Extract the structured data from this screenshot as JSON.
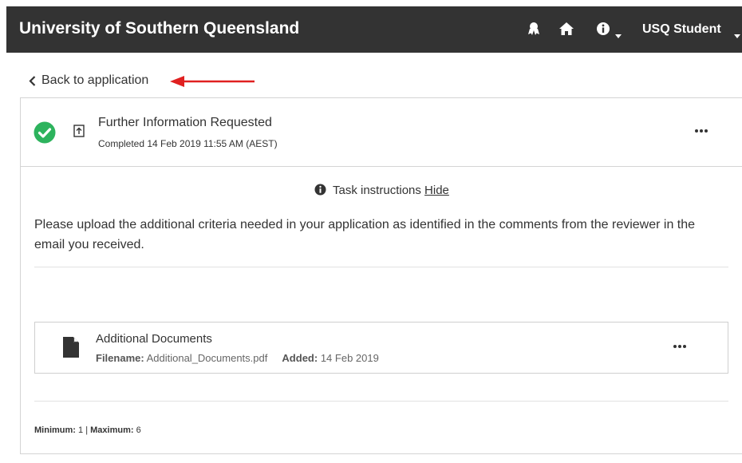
{
  "header": {
    "title": "University of Southern Queensland",
    "user_label": "USQ Student",
    "bg_color": "#333333"
  },
  "back_link": {
    "label": "Back to application"
  },
  "annotation_color": "#e02020",
  "task": {
    "title": "Further Information Requested",
    "status": "Completed 14 Feb 2019 11:55 AM (AEST)",
    "status_color": "#2db35d"
  },
  "instructions": {
    "heading": "Task instructions",
    "hide_label": "Hide",
    "body": "Please upload the additional criteria needed in your application as identified in the comments from the reviewer in the email you received."
  },
  "file": {
    "title": "Additional Documents",
    "filename_label": "Filename:",
    "filename": "Additional_Documents.pdf",
    "added_label": "Added:",
    "added": "14 Feb 2019"
  },
  "limits": {
    "min_label": "Minimum:",
    "min": "1",
    "separator": "|",
    "max_label": "Maximum:",
    "max": "6"
  }
}
